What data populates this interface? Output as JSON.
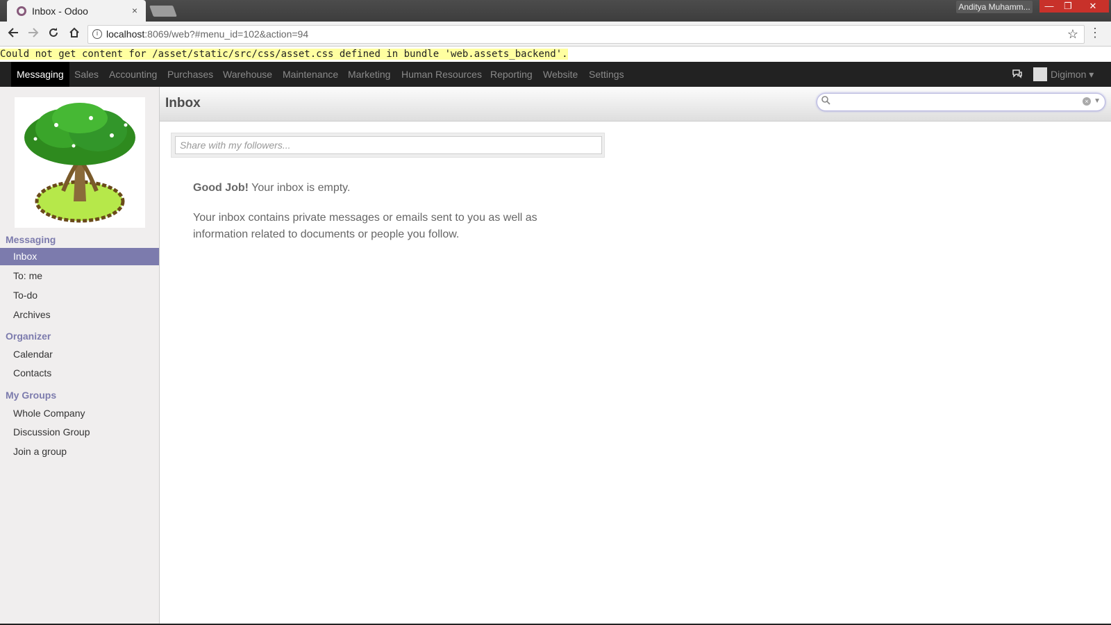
{
  "browser": {
    "tab_title": "Inbox - Odoo",
    "tab_close": "×",
    "user": "Anditya Muhamm...",
    "minimize": "—",
    "restore": "❐",
    "close": "✕",
    "url_host": "localhost",
    "url_path": ":8069/web?#menu_id=102&action=94"
  },
  "error_message": "Could not get content for /asset/static/src/css/asset.css defined in bundle 'web.assets_backend'.",
  "topbar": {
    "items": [
      "Messaging",
      "Sales",
      "Accounting",
      "Purchases",
      "Warehouse",
      "Maintenance",
      "Marketing",
      "Human Resources",
      "Reporting",
      "Website",
      "Settings"
    ],
    "active": "Messaging",
    "username": "Digimon",
    "caret": "▾"
  },
  "sidebar": {
    "sections": [
      {
        "title": "Messaging",
        "items": [
          "Inbox",
          "To: me",
          "To-do",
          "Archives"
        ]
      },
      {
        "title": "Organizer",
        "items": [
          "Calendar",
          "Contacts"
        ]
      },
      {
        "title": "My Groups",
        "items": [
          "Whole Company",
          "Discussion Group",
          "Join a group"
        ]
      }
    ],
    "selected": "Inbox"
  },
  "main": {
    "title": "Inbox",
    "compose_placeholder": "Share with my followers...",
    "empty_bold": "Good Job!",
    "empty_text": " Your inbox is empty.",
    "empty_desc": "Your inbox contains private messages or emails sent to you as well as information related to documents or people you follow."
  },
  "colors": {
    "accent": "#7c7bad",
    "topbar": "#222222",
    "brand": "#875a7b"
  },
  "icons": [
    "back-icon",
    "forward-icon",
    "reload-icon",
    "home-icon",
    "info-icon",
    "star-icon",
    "kebab-icon",
    "chat-icon",
    "search-icon",
    "clear-icon"
  ]
}
